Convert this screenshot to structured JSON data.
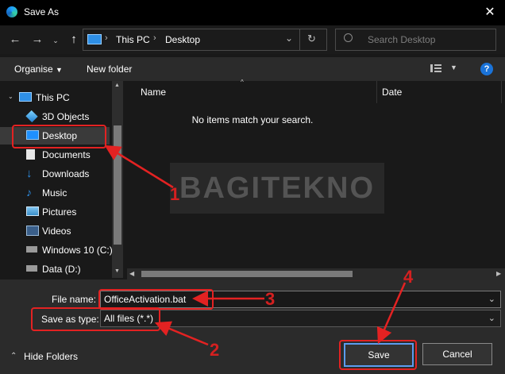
{
  "window": {
    "title": "Save As",
    "close_icon": "close-icon"
  },
  "nav": {
    "back_icon": "arrow-left-icon",
    "forward_icon": "arrow-right-icon",
    "recent_icon": "chevron-down-icon",
    "up_icon": "arrow-up-icon",
    "breadcrumb": [
      "This PC",
      "Desktop"
    ],
    "refresh_icon": "refresh-icon",
    "search_placeholder": "Search Desktop"
  },
  "toolbar": {
    "organise": "Organise",
    "new_folder": "New folder",
    "help": "?"
  },
  "tree": [
    {
      "label": "This PC",
      "icon": "pc-icon"
    },
    {
      "label": "3D Objects",
      "icon": "cube-icon"
    },
    {
      "label": "Desktop",
      "icon": "desktop-icon"
    },
    {
      "label": "Documents",
      "icon": "document-icon"
    },
    {
      "label": "Downloads",
      "icon": "download-icon"
    },
    {
      "label": "Music",
      "icon": "music-icon"
    },
    {
      "label": "Pictures",
      "icon": "picture-icon"
    },
    {
      "label": "Videos",
      "icon": "video-icon"
    },
    {
      "label": "Windows 10 (C:)",
      "icon": "drive-icon"
    },
    {
      "label": "Data (D:)",
      "icon": "drive-icon"
    }
  ],
  "columns": {
    "name": "Name",
    "date": "Date"
  },
  "empty_message": "No items match your search.",
  "watermark": "BAGITEKNO",
  "form": {
    "file_name_label": "File name:",
    "file_name_value": "OfficeActivation.bat",
    "save_type_label": "Save as type:",
    "save_type_value": "All files (*.*)"
  },
  "buttons": {
    "hide_folders": "Hide Folders",
    "save": "Save",
    "cancel": "Cancel"
  },
  "annotations": {
    "n1": "1",
    "n2": "2",
    "n3": "3",
    "n4": "4",
    "color": "#e32222"
  }
}
